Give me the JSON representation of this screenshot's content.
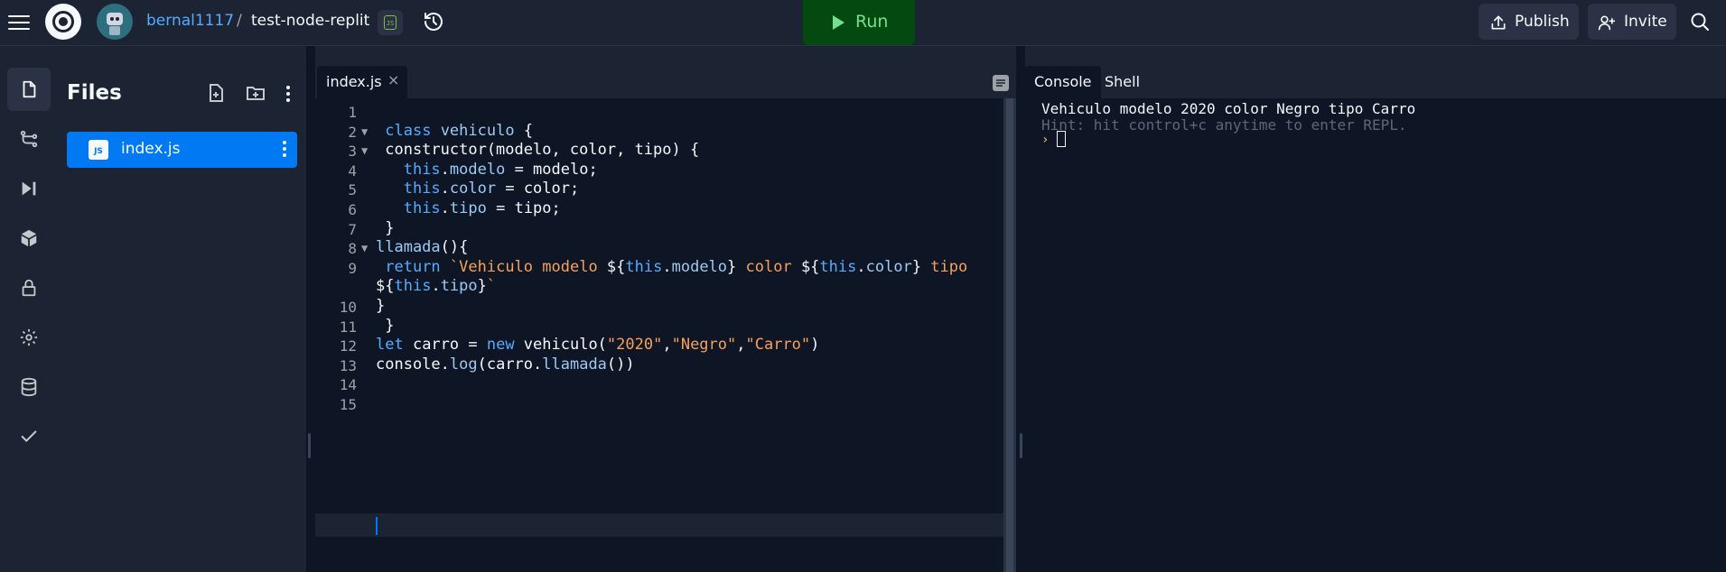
{
  "header": {
    "username": "bernal1117",
    "separator": "/",
    "repl_name": "test-node-replit",
    "language_badge": "JS",
    "run_label": "Run",
    "publish_label": "Publish",
    "invite_label": "Invite"
  },
  "sidebar": {
    "icons": [
      "files-icon",
      "git-branch-icon",
      "debugger-icon",
      "packages-icon",
      "secrets-lock-icon",
      "settings-gear-icon",
      "database-icon",
      "checkmark-icon"
    ],
    "active": "files-icon"
  },
  "files_panel": {
    "title": "Files",
    "files": [
      {
        "name": "index.js",
        "icon": "JS",
        "selected": true
      }
    ]
  },
  "editor": {
    "tab_label": "index.js",
    "tab_close": "×",
    "current_line": 15,
    "lines": [
      {
        "n": "1",
        "fold": "",
        "html": ""
      },
      {
        "n": "2",
        "fold": "▼",
        "html": " <span class=\"kw\">class</span> <span class=\"fn\">vehiculo</span> {"
      },
      {
        "n": "3",
        "fold": "▼",
        "html": " constructor(modelo, color, tipo) {"
      },
      {
        "n": "4",
        "fold": "",
        "html": "   <span class=\"kw\">this</span>.<span class=\"fn\">modelo</span> = modelo;"
      },
      {
        "n": "5",
        "fold": "",
        "html": "   <span class=\"kw\">this</span>.<span class=\"fn\">color</span> = color;"
      },
      {
        "n": "6",
        "fold": "",
        "html": "   <span class=\"kw\">this</span>.<span class=\"fn\">tipo</span> = tipo;"
      },
      {
        "n": "7",
        "fold": "",
        "html": " }"
      },
      {
        "n": "8",
        "fold": "▼",
        "html": "<span class=\"fn\">llamada</span>(){"
      },
      {
        "n": "9",
        "fold": "",
        "html": " <span class=\"kw\">return</span> <span class=\"str\">`Vehiculo modelo </span>${<span class=\"kw\">this</span>.<span class=\"fn\">modelo</span>}<span class=\"str\"> color </span>${<span class=\"kw\">this</span>.<span class=\"fn\">color</span>}<span class=\"str\"> tipo</span>"
      },
      {
        "n": "",
        "fold": "",
        "html": "${<span class=\"kw\">this</span>.<span class=\"fn\">tipo</span>}<span class=\"str\">`</span>"
      },
      {
        "n": "10",
        "fold": "",
        "html": "}"
      },
      {
        "n": "11",
        "fold": "",
        "html": " }"
      },
      {
        "n": "12",
        "fold": "",
        "html": "<span class=\"kw\">let</span> carro = <span class=\"kw\">new</span> vehiculo(<span class=\"str\">\"2020\"</span>,<span class=\"str\">\"Negro\"</span>,<span class=\"str\">\"Carro\"</span>)"
      },
      {
        "n": "13",
        "fold": "",
        "html": "console.<span class=\"fn\">log</span>(carro.<span class=\"fn\">llamada</span>())"
      },
      {
        "n": "14",
        "fold": "",
        "html": ""
      },
      {
        "n": "15",
        "fold": "",
        "html": ""
      }
    ]
  },
  "console": {
    "tabs": [
      {
        "label": "Console",
        "active": true
      },
      {
        "label": "Shell",
        "active": false
      }
    ],
    "output": "Vehiculo modelo 2020 color Negro tipo Carro",
    "hint": "Hint: hit control+c anytime to enter REPL.",
    "prompt": "›"
  },
  "colors": {
    "accent": "#0079f2",
    "run_bg": "#044a10",
    "run_fg": "#73e08f",
    "keyword": "#57abff",
    "string": "#f6a15b"
  }
}
